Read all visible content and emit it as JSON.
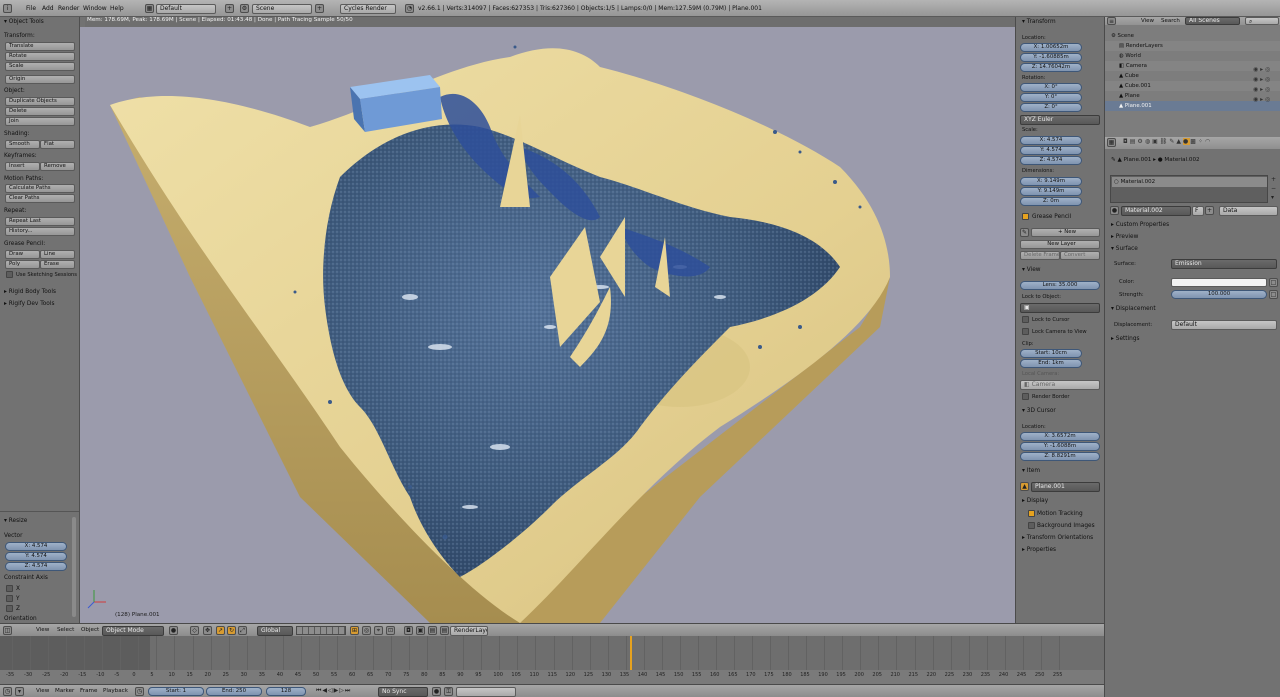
{
  "topbar": {
    "menus": [
      "File",
      "Add",
      "Render",
      "Window",
      "Help"
    ],
    "screen_layout": "Default",
    "scene": "Scene",
    "engine": "Cycles Render",
    "stats": "v2.66.1 | Verts:314097 | Faces:627353 | Tris:627360 | Objects:1/5 | Lamps:0/0 | Mem:127.59M (0.79M) | Plane.001"
  },
  "viewport": {
    "status": "Mem: 178.69M, Peak: 178.69M | Scene | Elapsed: 01:43.48 | Done | Path Tracing Sample 50/50",
    "object_label": "(128) Plane.001"
  },
  "toolshelf": {
    "title": "Object Tools",
    "transform_label": "Transform:",
    "transform": [
      "Translate",
      "Rotate",
      "Scale"
    ],
    "origin": "Origin",
    "object_label": "Object:",
    "object_ops": [
      "Duplicate Objects",
      "Delete",
      "Join"
    ],
    "shading_label": "Shading:",
    "smooth": "Smooth",
    "flat": "Flat",
    "keyframes_label": "Keyframes:",
    "insert": "Insert",
    "remove": "Remove",
    "motion_label": "Motion Paths:",
    "calc_paths": "Calculate Paths",
    "clear_paths": "Clear Paths",
    "repeat_label": "Repeat:",
    "repeat_last": "Repeat Last",
    "history": "History...",
    "grease_label": "Grease Pencil:",
    "draw": "Draw",
    "line": "Line",
    "poly": "Poly",
    "erase": "Erase",
    "sketching": "Use Sketching Sessions",
    "rigid": "Rigid Body Tools",
    "rigify": "Rigify Dev Tools"
  },
  "operator": {
    "title": "Resize",
    "vector_label": "Vector",
    "x": "X: 4.574",
    "y": "Y: 4.574",
    "z": "Z: 4.574",
    "constraint_label": "Constraint Axis",
    "cx": "X",
    "cy": "Y",
    "cz": "Z",
    "orientation_label": "Orientation"
  },
  "npanel": {
    "transform_title": "Transform",
    "location_label": "Location:",
    "loc_x": "X: 1.00652m",
    "loc_y": "Y: -1.60885m",
    "loc_z": "Z: 14.76042m",
    "rotation_label": "Rotation:",
    "rot_x": "X: 0°",
    "rot_y": "Y: 0°",
    "rot_z": "Z: 0°",
    "rot_mode": "XYZ Euler",
    "scale_label": "Scale:",
    "scale_x": "X: 4.574",
    "scale_y": "Y: 4.574",
    "scale_z": "Z: 4.574",
    "dimensions_label": "Dimensions:",
    "dim_x": "X: 9.149m",
    "dim_y": "Y: 9.149m",
    "dim_z": "Z: 0m",
    "grease_title": "Grease Pencil",
    "gp_new": "New",
    "gp_new_layer": "New Layer",
    "gp_delete_frame": "Delete Frame",
    "gp_convert": "Convert",
    "view_title": "View",
    "lens": "Lens: 35.000",
    "lock_to_object": "Lock to Object:",
    "lock_cursor": "Lock to Cursor",
    "lock_camera": "Lock Camera to View",
    "clip_label": "Clip:",
    "clip_start": "Start: 10cm",
    "clip_end": "End: 1km",
    "local_camera": "Local Camera:",
    "camera": "Camera",
    "render_border": "Render Border",
    "cursor_title": "3D Cursor",
    "cursor_location_label": "Location:",
    "cur_x": "X: 3.6572m",
    "cur_y": "Y: -1.6088m",
    "cur_z": "Z: 8.8291m",
    "item_title": "Item",
    "item_name": "Plane.001",
    "display_title": "Display",
    "motion_tracking": "Motion Tracking",
    "background_images": "Background Images",
    "transform_orient": "Transform Orientations",
    "properties": "Properties"
  },
  "outliner": {
    "view": "View",
    "search": "Search",
    "filter": "All Scenes",
    "items": [
      "Scene",
      "RenderLayers",
      "World",
      "Camera",
      "Cube",
      "Cube.001",
      "Plane",
      "Plane.001"
    ]
  },
  "properties": {
    "breadcrumb_obj": "Plane.001",
    "breadcrumb_mat": "Material.002",
    "slot_name": "Material.002",
    "mat_name": "Material.002",
    "mat_users": "F",
    "data_link": "Data",
    "custom_props": "Custom Properties",
    "preview": "Preview",
    "surface_title": "Surface",
    "surface_label": "Surface:",
    "surface_value": "Emission",
    "color_label": "Color:",
    "strength_label": "Strength:",
    "strength_value": "100.000",
    "displacement_title": "Displacement",
    "displacement_label": "Displacement:",
    "displacement_value": "Default",
    "settings": "Settings"
  },
  "view3d_header": {
    "view": "View",
    "select": "Select",
    "object": "Object",
    "mode": "Object Mode",
    "orientation": "Global",
    "layer": "RenderLayer"
  },
  "timeline": {
    "ticks": [
      "-35",
      "-30",
      "-25",
      "-20",
      "-15",
      "-10",
      "-5",
      "0",
      "5",
      "10",
      "15",
      "20",
      "25",
      "30",
      "35",
      "40",
      "45",
      "50",
      "55",
      "60",
      "65",
      "70",
      "75",
      "80",
      "85",
      "90",
      "95",
      "100",
      "105",
      "110",
      "115",
      "120",
      "125",
      "130",
      "135",
      "140",
      "145",
      "150",
      "155",
      "160",
      "165",
      "170",
      "175",
      "180",
      "185",
      "190",
      "195",
      "200",
      "205",
      "210",
      "215",
      "220",
      "225",
      "230",
      "235",
      "240",
      "245",
      "250",
      "255"
    ],
    "view": "View",
    "marker": "Marker",
    "frame": "Frame",
    "playback": "Playback",
    "start": "Start: 1",
    "end": "End: 250",
    "current": "128",
    "sync": "No Sync"
  },
  "colors": {
    "accent": "#e6a21f",
    "sand": "#e6d49a",
    "water": "#3d5674",
    "viewport_bg": "#9b9bac",
    "vector_field": "#8fa3bd"
  }
}
